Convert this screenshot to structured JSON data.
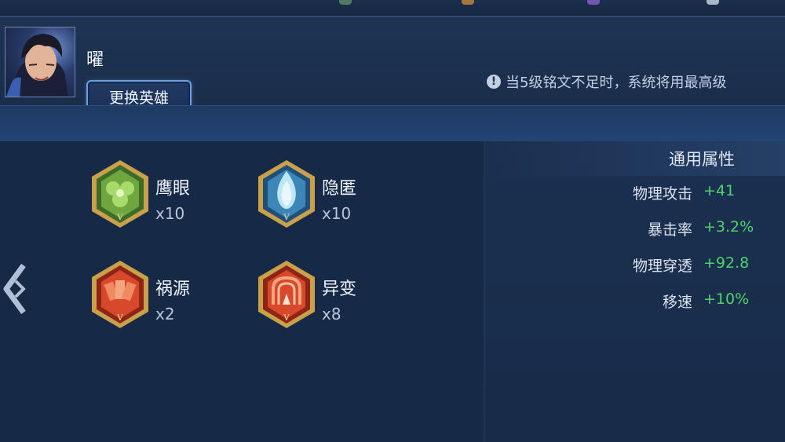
{
  "hero": {
    "name": "曜",
    "switch_button": "更换英雄"
  },
  "notice": {
    "icon": "info-icon",
    "text": "当5级铭文不足时，系统将用最高级"
  },
  "inscriptions": [
    {
      "name": "鹰眼",
      "count": "x10",
      "icon": "hawk-eye-green-gem-icon",
      "color": "#7db84a"
    },
    {
      "name": "隐匿",
      "count": "x10",
      "icon": "stealth-blue-flame-icon",
      "color": "#5aa5d6"
    },
    {
      "name": "祸源",
      "count": "x2",
      "icon": "calamity-red-cards-icon",
      "color": "#d8492c"
    },
    {
      "name": "异变",
      "count": "x8",
      "icon": "mutation-red-gate-icon",
      "color": "#d8492c"
    }
  ],
  "properties": {
    "title": "通用属性",
    "items": [
      {
        "name": "物理攻击",
        "value": "+41"
      },
      {
        "name": "暴击率",
        "value": "+3.2%"
      },
      {
        "name": "物理穿透",
        "value": "+92.8"
      },
      {
        "name": "移速",
        "value": "+10%"
      }
    ]
  },
  "colors": {
    "bonus_green": "#4fd36b",
    "gold_frame": "#c9a14a",
    "accent_blue": "#6d9fe0"
  }
}
